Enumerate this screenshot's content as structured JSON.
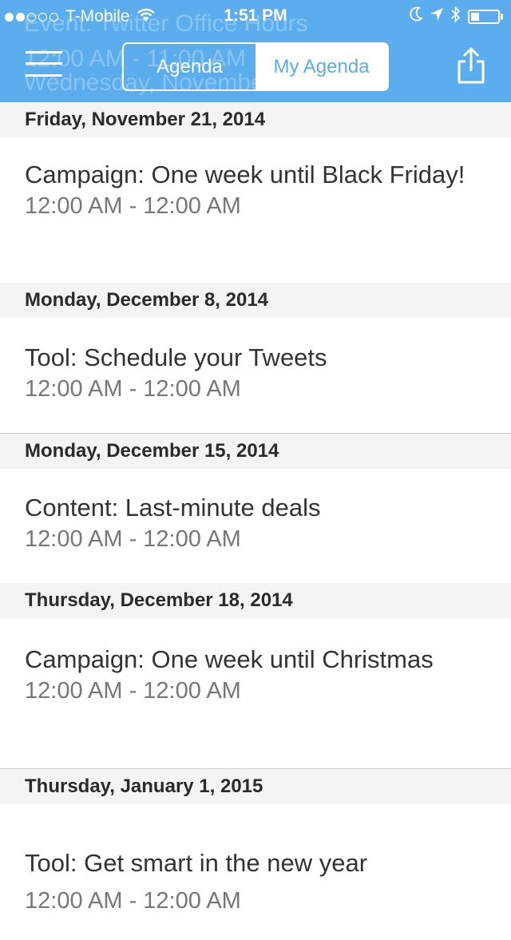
{
  "status_bar": {
    "carrier": "T-Mobile",
    "time": "1:51 PM",
    "signal": {
      "filled": 2,
      "total": 5
    },
    "icons": [
      "wifi-icon",
      "moon-icon",
      "location-arrow-icon",
      "bluetooth-icon",
      "battery-icon"
    ],
    "battery_level": 0.3
  },
  "header": {
    "background_text": {
      "line1": "Event: Twitter Office Hours",
      "line2": "12:00 AM - 11:00 AM",
      "line3": "Wednesday, November"
    },
    "segments": [
      {
        "label": "Agenda",
        "selected": false
      },
      {
        "label": "My Agenda",
        "selected": true
      }
    ],
    "accent_color": "#5badee"
  },
  "sections": [
    {
      "date": "Friday, November 21, 2014",
      "items": [
        {
          "title": "Campaign: One week until Black Friday!",
          "time": "12:00 AM - 12:00 AM"
        }
      ]
    },
    {
      "date": "Monday, December 8, 2014",
      "items": [
        {
          "title": "Tool: Schedule your Tweets",
          "time": "12:00 AM - 12:00 AM"
        }
      ]
    },
    {
      "date": "Monday, December 15, 2014",
      "items": [
        {
          "title": "Content: Last-minute deals",
          "time": "12:00 AM - 12:00 AM"
        }
      ]
    },
    {
      "date": "Thursday, December 18, 2014",
      "items": [
        {
          "title": "Campaign: One week until Christmas",
          "time": "12:00 AM - 12:00 AM"
        }
      ]
    },
    {
      "date": "Thursday, January 1, 2015",
      "items": [
        {
          "title": "Tool: Get smart in the new year",
          "time": "12:00 AM - 12:00 AM"
        }
      ]
    }
  ]
}
